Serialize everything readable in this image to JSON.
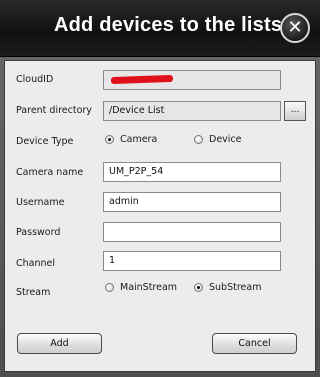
{
  "dialog": {
    "title": "Add devices to the lists",
    "close_label": "✕"
  },
  "form": {
    "cloud_id": {
      "label": "CloudID",
      "value": ""
    },
    "parent_directory": {
      "label": "Parent directory",
      "value": "/Device List",
      "browse_label": "..."
    },
    "device_type": {
      "label": "Device Type",
      "options": [
        {
          "label": "Camera",
          "selected": true
        },
        {
          "label": "Device",
          "selected": false
        }
      ]
    },
    "camera_name": {
      "label": "Camera name",
      "value": "UM_P2P_54"
    },
    "username": {
      "label": "Username",
      "value": "admin"
    },
    "password": {
      "label": "Password",
      "value": ""
    },
    "channel": {
      "label": "Channel",
      "value": "1"
    },
    "stream": {
      "label": "Stream",
      "options": [
        {
          "label": "MainStream",
          "selected": false
        },
        {
          "label": "SubStream",
          "selected": true
        }
      ]
    }
  },
  "buttons": {
    "add_label": "Add",
    "cancel_label": "Cancel"
  }
}
